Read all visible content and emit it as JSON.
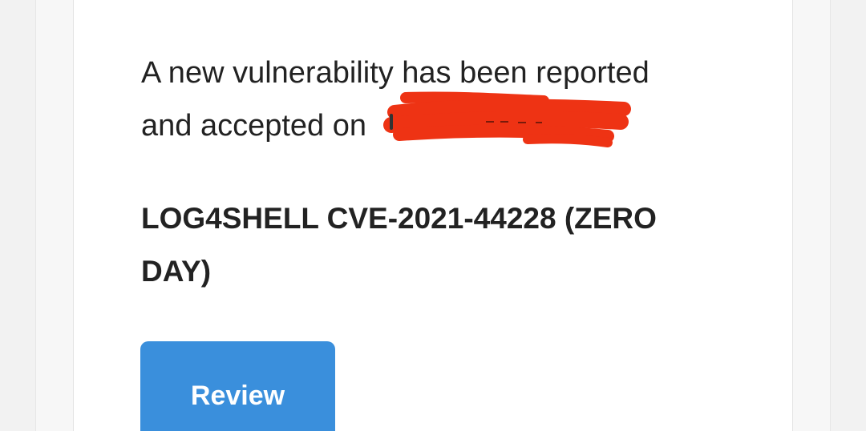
{
  "email": {
    "message_line1": "A new vulnerability has been reported",
    "message_line2": "and accepted on",
    "vulnerability_title_line1": "LOG4SHELL CVE-2021-44228 (ZERO",
    "vulnerability_title_line2": "DAY)",
    "review_label": "Review"
  },
  "colors": {
    "button": "#3a8fdc",
    "redaction": "#ee3314",
    "text": "#222222",
    "card_background": "#ffffff",
    "page_background": "#f2f2f2"
  }
}
